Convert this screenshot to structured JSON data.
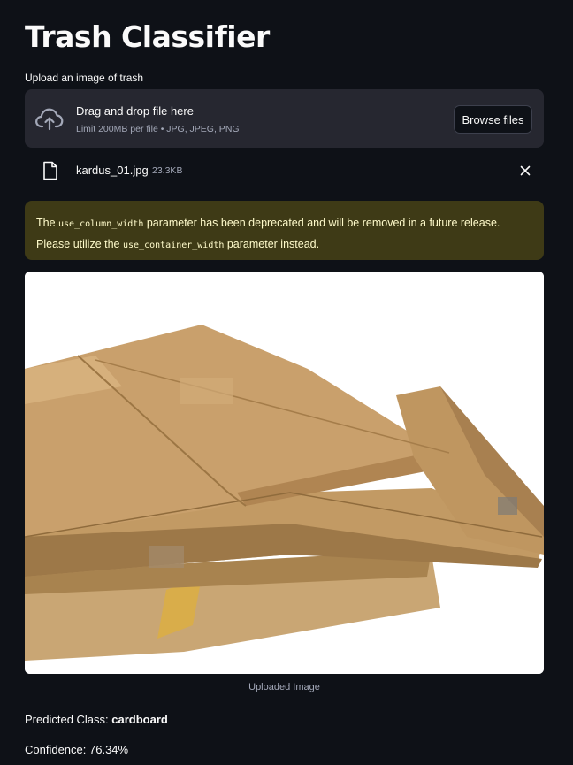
{
  "app": {
    "title": "Trash Classifier"
  },
  "uploader": {
    "label": "Upload an image of trash",
    "drop_text": "Drag and drop file here",
    "limit_text": "Limit 200MB per file • JPG, JPEG, PNG",
    "browse_label": "Browse files",
    "upload_icon": "cloud-upload-icon"
  },
  "file": {
    "name": "kardus_01.jpg",
    "size": "23.3KB",
    "file_icon": "file-icon",
    "remove_icon": "close-icon"
  },
  "warning": {
    "part1": "The ",
    "code1": "use_column_width",
    "part2": " parameter has been deprecated and will be removed in a future release. Please utilize the ",
    "code2": "use_container_width",
    "part3": " parameter instead."
  },
  "image": {
    "caption": "Uploaded Image",
    "subject": "flattened cardboard boxes"
  },
  "result": {
    "predicted_label": "Predicted Class: ",
    "predicted_value": "cardboard",
    "confidence_text": "Confidence: 76.34%"
  },
  "colors": {
    "background": "#0e1117",
    "panel": "#262730",
    "warning_bg": "#3e3a16",
    "warning_text": "#fffbcb"
  }
}
